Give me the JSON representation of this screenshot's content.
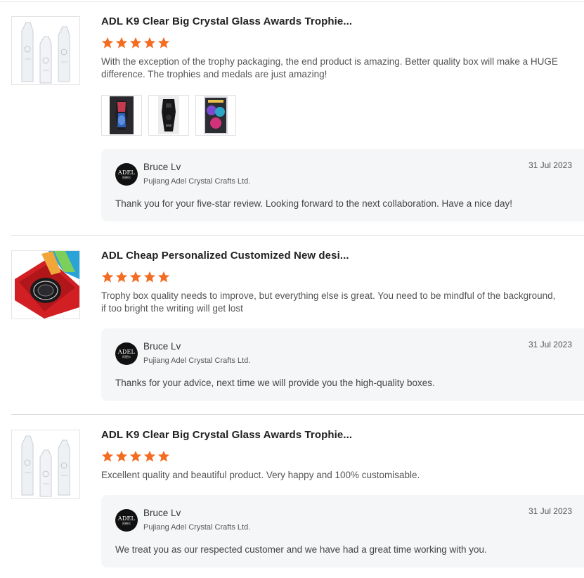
{
  "colors": {
    "star": "#f36c21",
    "reply_bg": "#f5f6f8",
    "divider": "#dcdcdc"
  },
  "reviews": [
    {
      "product_title": "ADL K9 Clear Big Crystal Glass Awards Trophie...",
      "rating": 5,
      "comment": "With the exception of the trophy packaging, the end product is amazing. Better quality box will make a HUGE difference. The trophies and medals are just amazing!",
      "photos": [
        "photo-1",
        "photo-2",
        "photo-3"
      ],
      "reply": {
        "seller_name": "Bruce Lv",
        "seller_company": "Pujiang Adel Crystal Crafts Ltd.",
        "date": "31 Jul 2023",
        "text": "Thank you for your five-star review. Looking forward to the next collaboration. Have a nice day!"
      }
    },
    {
      "product_title": "ADL Cheap Personalized Customized New desi...",
      "rating": 5,
      "comment": "Trophy box quality needs to improve, but everything else is great. You need to be mindful of the background, if too bright the writing will get lost",
      "reply": {
        "seller_name": "Bruce Lv",
        "seller_company": "Pujiang Adel Crystal Crafts Ltd.",
        "date": "31 Jul 2023",
        "text": "Thanks for your advice, next time we will provide you the high-quality boxes."
      }
    },
    {
      "product_title": "ADL K9 Clear Big Crystal Glass Awards Trophie...",
      "rating": 5,
      "comment": "Excellent quality and beautiful product. Very happy and 100% customisable.",
      "reply": {
        "seller_name": "Bruce Lv",
        "seller_company": "Pujiang Adel Crystal Crafts Ltd.",
        "date": "31 Jul 2023",
        "text": "We treat you as our  respected customer and we have had a great time working with you."
      }
    }
  ],
  "avatar": {
    "monogram": "ADEL",
    "subtext": "阿德尔"
  }
}
